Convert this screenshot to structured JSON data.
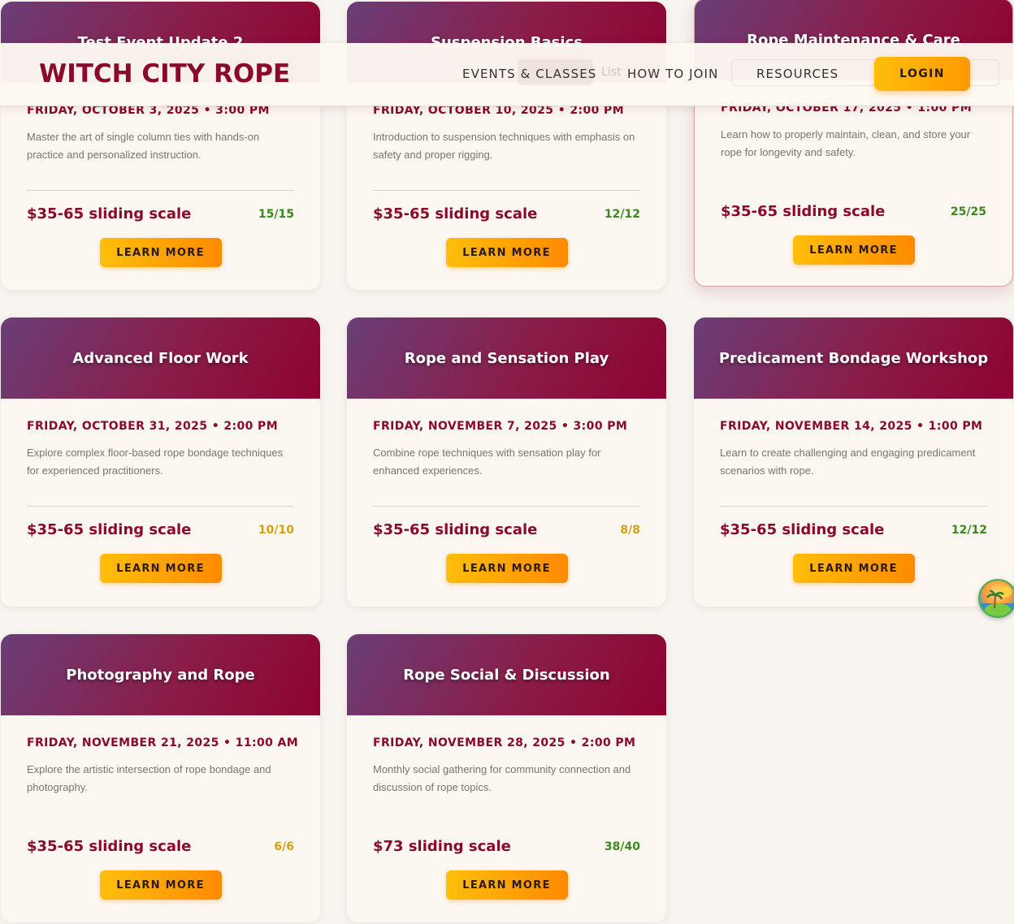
{
  "header": {
    "logo": "WITCH CITY ROPE",
    "nav": [
      "EVENTS & CLASSES",
      "HOW TO JOIN",
      "RESOURCES"
    ],
    "login_label": "LOGIN",
    "ghost_text": "List"
  },
  "cards": [
    {
      "title": "Test Event Update 2",
      "date": "FRIDAY, OCTOBER 3, 2025 • 3:00 PM",
      "description": "Master the art of single column ties with hands-on practice and personalized instruction.",
      "price": "$35-65 sliding scale",
      "spots": "15/15",
      "spots_color": "#3a8a1e",
      "button": "LEARN MORE"
    },
    {
      "title": "Suspension Basics",
      "date": "FRIDAY, OCTOBER 10, 2025 • 2:00 PM",
      "description": "Introduction to suspension techniques with emphasis on safety and proper rigging.",
      "price": "$35-65 sliding scale",
      "spots": "12/12",
      "spots_color": "#3a8a1e",
      "button": "LEARN MORE"
    },
    {
      "title": "Rope Maintenance & Care",
      "date": "FRIDAY, OCTOBER 17, 2025 • 1:00 PM",
      "description": "Learn how to properly maintain, clean, and store your rope for longevity and safety.",
      "price": "$35-65 sliding scale",
      "spots": "25/25",
      "spots_color": "#3a8a1e",
      "button": "LEARN MORE"
    },
    {
      "title": "Advanced Floor Work",
      "date": "FRIDAY, OCTOBER 31, 2025 • 2:00 PM",
      "description": "Explore complex floor-based rope bondage techniques for experienced practitioners.",
      "price": "$35-65 sliding scale",
      "spots": "10/10",
      "spots_color": "#d4a012",
      "button": "LEARN MORE"
    },
    {
      "title": "Rope and Sensation Play",
      "date": "FRIDAY, NOVEMBER 7, 2025 • 3:00 PM",
      "description": "Combine rope techniques with sensation play for enhanced experiences.",
      "price": "$35-65 sliding scale",
      "spots": "8/8",
      "spots_color": "#d4a012",
      "button": "LEARN MORE"
    },
    {
      "title": "Predicament Bondage Workshop",
      "date": "FRIDAY, NOVEMBER 14, 2025 • 1:00 PM",
      "description": "Learn to create challenging and engaging predicament scenarios with rope.",
      "price": "$35-65 sliding scale",
      "spots": "12/12",
      "spots_color": "#3a8a1e",
      "button": "LEARN MORE"
    },
    {
      "title": "Photography and Rope",
      "date": "FRIDAY, NOVEMBER 21, 2025 • 11:00 AM",
      "description": "Explore the artistic intersection of rope bondage and photography.",
      "price": "$35-65 sliding scale",
      "spots": "6/6",
      "spots_color": "#d4a012",
      "button": "LEARN MORE"
    },
    {
      "title": "Rope Social & Discussion",
      "date": "FRIDAY, NOVEMBER 28, 2025 • 2:00 PM",
      "description": "Monthly social gathering for community connection and discussion of rope topics.",
      "price": "$73 sliding scale",
      "spots": "38/40",
      "spots_color": "#3a8a1e",
      "button": "LEARN MORE"
    }
  ],
  "colors": {
    "brand": "#8b0a2a",
    "accent_button": "#ffbe0b",
    "background": "#f8f4ef"
  },
  "floating_badge_icon": "island-sunset-icon"
}
